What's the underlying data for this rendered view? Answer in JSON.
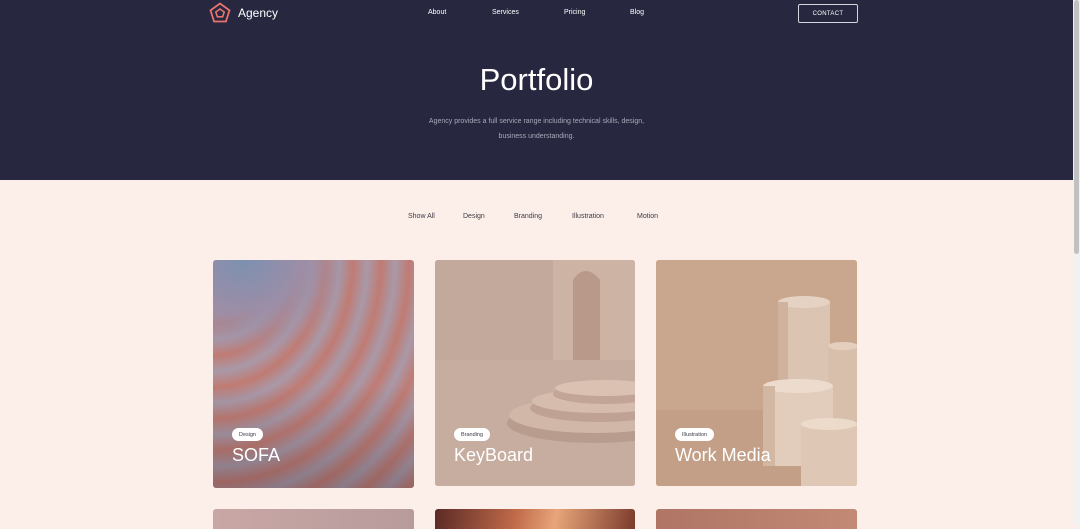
{
  "header": {
    "brand": "Agency",
    "nav": [
      "About",
      "Services",
      "Pricing",
      "Blog"
    ],
    "contact_label": "CONTACT"
  },
  "hero": {
    "title": "Portfolio",
    "desc_line1": "Agency provides a full service range including technical skills, design,",
    "desc_line2": "business understanding."
  },
  "filters": [
    "Show All",
    "Design",
    "Branding",
    "Illustration",
    "Motion"
  ],
  "cards": [
    {
      "tag": "Design",
      "title": "SOFA"
    },
    {
      "tag": "Branding",
      "title": "KeyBoard"
    },
    {
      "tag": "Illustration",
      "title": "Work Media"
    }
  ],
  "colors": {
    "hero_bg": "#272840",
    "page_bg": "#fcefe9",
    "logo_accent": "#e8736a"
  },
  "icons": {
    "logo": "pentagon-logo-icon"
  }
}
